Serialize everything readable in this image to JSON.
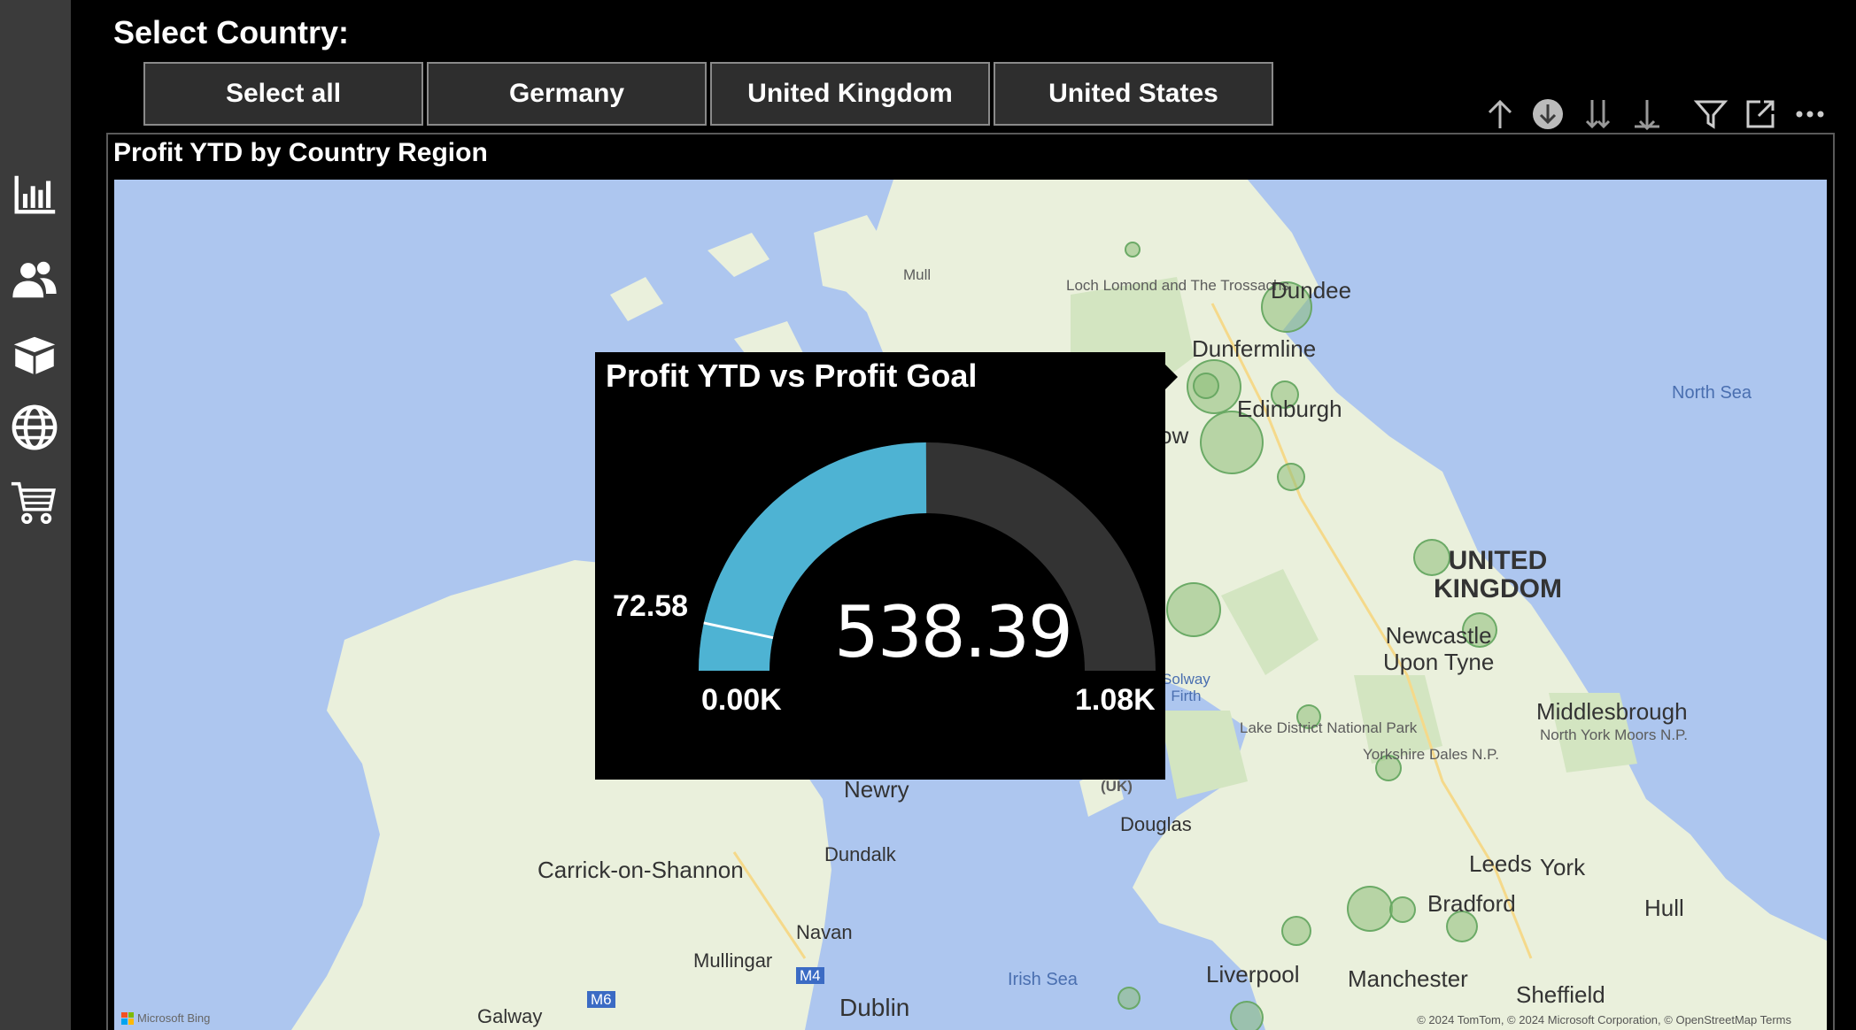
{
  "nav": {
    "items": [
      {
        "icon": "bar-chart-icon"
      },
      {
        "icon": "people-icon"
      },
      {
        "icon": "box-icon"
      },
      {
        "icon": "globe-icon"
      },
      {
        "icon": "shopping-cart-icon"
      }
    ]
  },
  "header": {
    "select_label": "Select Country:",
    "slicers": [
      "Select all",
      "Germany",
      "United Kingdom",
      "United States"
    ]
  },
  "toolbar": {
    "icons": [
      "drill-up-icon",
      "drill-down-icon",
      "expand-all-down-icon",
      "drill-hierarchy-icon",
      "filter-icon",
      "focus-mode-icon",
      "more-options-icon"
    ]
  },
  "visual": {
    "title": "Profit YTD by Country Region"
  },
  "map": {
    "labels": {
      "dundee": "Dundee",
      "dunfermline": "Dunfermline",
      "edinburgh": "Edinburgh",
      "glasgow_suffix": "ow",
      "north_sea": "North Sea",
      "uk_line1": "UNITED",
      "uk_line2": "KINGDOM",
      "newcastle_line1": "Newcastle",
      "newcastle_line2": "Upon Tyne",
      "solway_line1": "Solway",
      "solway_line2": "Firth",
      "lake_district": "Lake District National Park",
      "yorkshire_dales": "Yorkshire Dales N.P.",
      "middlesbrough": "Middlesbrough",
      "north_york": "North York Moors N.P.",
      "newry": "Newry",
      "uk_abbr": "(UK)",
      "douglas": "Douglas",
      "dundalk": "Dundalk",
      "carrick": "Carrick-on-Shannon",
      "navan": "Navan",
      "mullingar": "Mullingar",
      "m4": "M4",
      "m6": "M6",
      "galway": "Galway",
      "dublin": "Dublin",
      "irish_sea": "Irish Sea",
      "liverpool": "Liverpool",
      "manchester": "Manchester",
      "sheffield": "Sheffield",
      "leeds": "Leeds",
      "york": "York",
      "bradford": "Bradford",
      "hull": "Hull",
      "mull": "Mull",
      "loch_lomond": "Loch Lomond and The Trossachs"
    },
    "attribution_left": "Microsoft Bing",
    "attribution_right": "© 2024 TomTom, © 2024 Microsoft Corporation, © OpenStreetMap  Terms"
  },
  "gauge": {
    "title": "Profit YTD vs Profit Goal",
    "value_label": "538.39",
    "min_label": "0.00K",
    "max_label": "1.08K",
    "target_label": "72.58",
    "value": 538.39,
    "min": 0,
    "max": 1080,
    "target": 72.58,
    "fill_color": "#4eb3d3",
    "track_color": "#333333"
  }
}
